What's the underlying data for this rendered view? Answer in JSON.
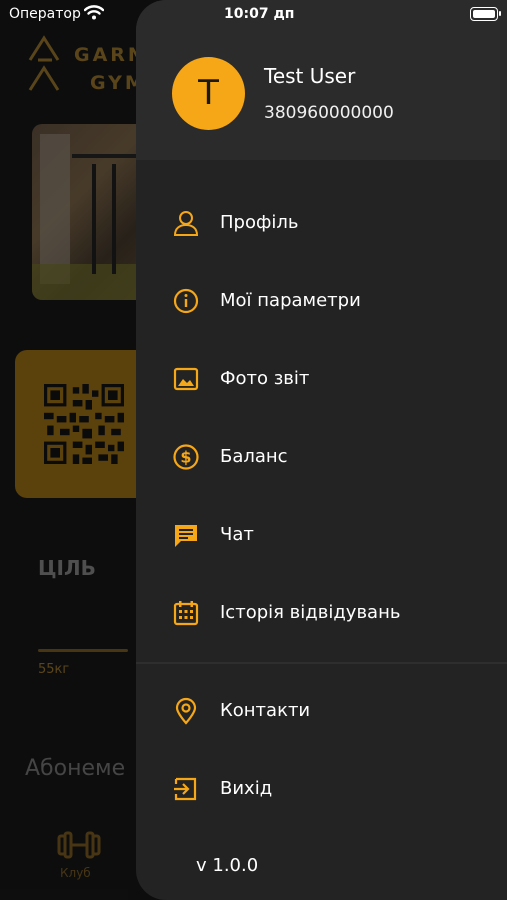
{
  "status_bar": {
    "carrier": "Оператор",
    "time": "10:07 дп"
  },
  "background": {
    "logo_line1": "GARN",
    "logo_line2": "GYM",
    "goal_label": "ЦІЛЬ",
    "goal_value": "55кг",
    "subscriptions_label": "Абонеме",
    "tab_club": "Клуб"
  },
  "drawer": {
    "avatar_initial": "T",
    "user_name": "Test User",
    "user_phone": "380960000000",
    "items": [
      {
        "label": "Профіль",
        "icon": "person-icon"
      },
      {
        "label": "Мої параметри",
        "icon": "info-icon"
      },
      {
        "label": "Фото звіт",
        "icon": "image-icon"
      },
      {
        "label": "Баланс",
        "icon": "dollar-icon"
      },
      {
        "label": "Чат",
        "icon": "chat-icon"
      },
      {
        "label": "Історія відвідувань",
        "icon": "calendar-icon"
      }
    ],
    "bottom_items": [
      {
        "label": "Контакти",
        "icon": "location-pin-icon"
      },
      {
        "label": "Вихід",
        "icon": "logout-icon"
      }
    ],
    "version": "v 1.0.0"
  },
  "colors": {
    "accent": "#F5A718",
    "drawer_bg": "#232323",
    "header_bg": "#2B2B2B"
  }
}
